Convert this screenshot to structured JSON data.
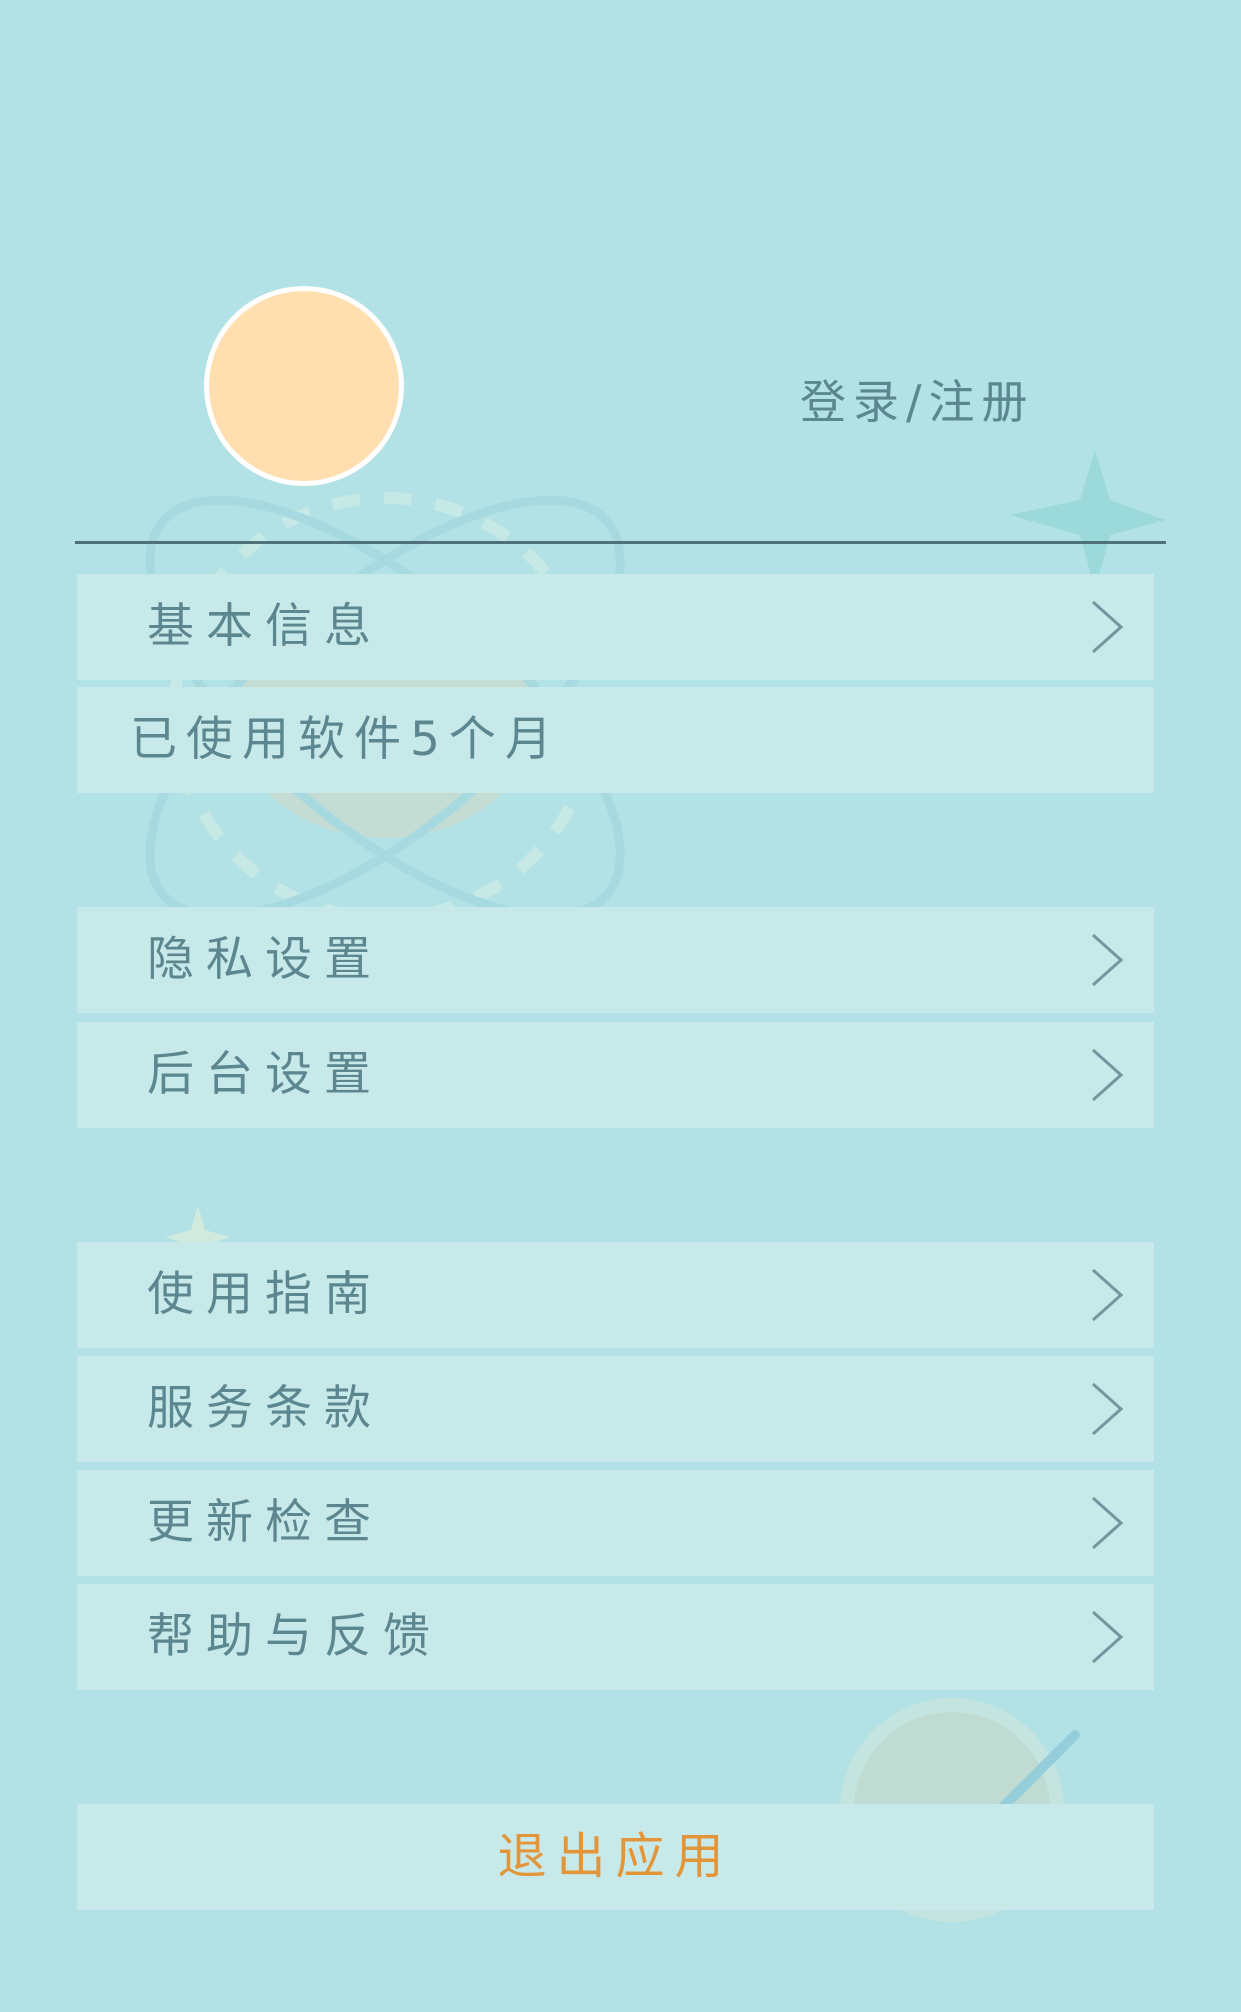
{
  "profile": {
    "login_label": "登录/注册"
  },
  "menu": {
    "basic_info": "基本信息",
    "usage_info": "已使用软件5个月",
    "privacy_settings": "隐私设置",
    "background_settings": "后台设置",
    "user_guide": "使用指南",
    "terms_of_service": "服务条款",
    "check_update": "更新检查",
    "help_feedback": "帮助与反馈"
  },
  "exit_label": "退出应用",
  "colors": {
    "background": "#b2e2e5",
    "row_background": "#c8e9e9",
    "text": "#5d8790",
    "exit_text": "#e3953a",
    "avatar": "#ffdeb0"
  },
  "icons": {
    "row_arrow": "chevron-right-icon"
  }
}
